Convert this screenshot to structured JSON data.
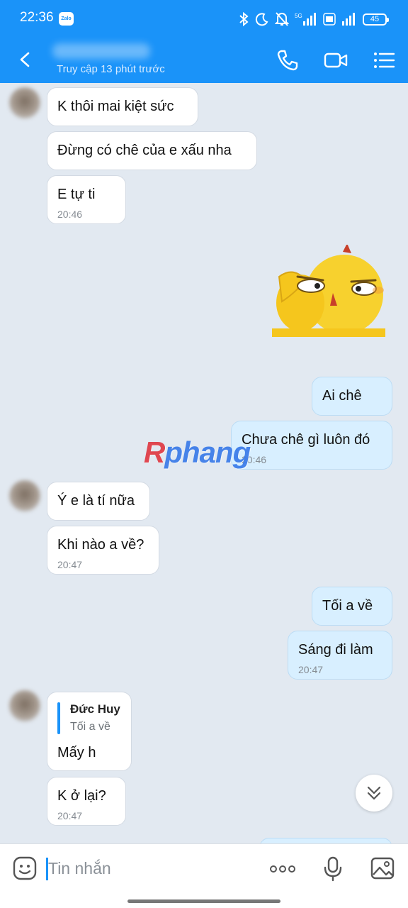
{
  "status_bar": {
    "time": "22:36",
    "app_badge": "Zalo",
    "battery": "45",
    "network": "5G"
  },
  "header": {
    "last_seen": "Truy cập 13 phút trước"
  },
  "messages": [
    {
      "dir": "in",
      "text": "K thôi mai kiệt sức"
    },
    {
      "dir": "in",
      "text": "Đừng có chê của e xấu nha"
    },
    {
      "dir": "in",
      "text": "E tự ti",
      "time": "20:46"
    },
    {
      "dir": "out",
      "sticker": "yellow-chick-sticker"
    },
    {
      "dir": "out",
      "text": "Ai chê"
    },
    {
      "dir": "out",
      "text": "Chưa chê gì luôn đó",
      "time": "20:46"
    },
    {
      "dir": "in",
      "text": "Ý e là tí nữa"
    },
    {
      "dir": "in",
      "text": "Khi nào a về?",
      "time": "20:47"
    },
    {
      "dir": "out",
      "text": "Tối a về"
    },
    {
      "dir": "out",
      "text": "Sáng đi làm",
      "time": "20:47"
    },
    {
      "dir": "in",
      "quote_name": "Đức Huy",
      "quote_text": "Tối a về",
      "text": "Mấy h"
    },
    {
      "dir": "in",
      "text": "K ở lại?",
      "time": "20:47"
    }
  ],
  "watermark": {
    "first": "R",
    "rest": "phang"
  },
  "input": {
    "placeholder": "Tin nhắn"
  },
  "colors": {
    "accent": "#1a93f9",
    "outgoing_bubble": "#d8efff",
    "chat_bg": "#e2e9f1"
  }
}
